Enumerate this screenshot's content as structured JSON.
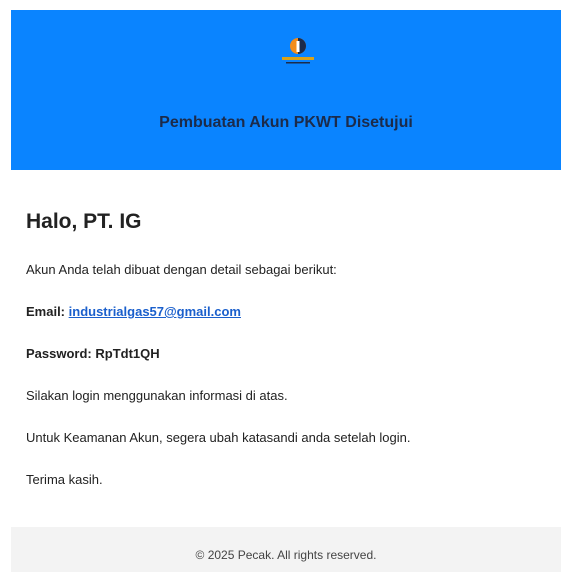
{
  "header": {
    "logo_icon": "company-logo-icon",
    "title": "Pembuatan Akun PKWT Disetujui",
    "background_color": "#0a84ff"
  },
  "body": {
    "greeting": "Halo, PT. IG",
    "intro": "Akun Anda telah dibuat dengan detail sebagai berikut:",
    "email_label": "Email:",
    "email_value": "industrialgas57@gmail.com",
    "password_label": "Password:",
    "password_value": "RpTdt1QH",
    "login_instruction": "Silakan login menggunakan informasi di atas.",
    "security_note": "Untuk Keamanan Akun, segera ubah katasandi anda setelah login.",
    "closing": "Terima kasih."
  },
  "footer": {
    "copyright": "© 2025 Pecak. All rights reserved."
  },
  "colors": {
    "header_bg": "#0a84ff",
    "link": "#1a5fcc",
    "footer_bg": "#f3f3f3"
  }
}
